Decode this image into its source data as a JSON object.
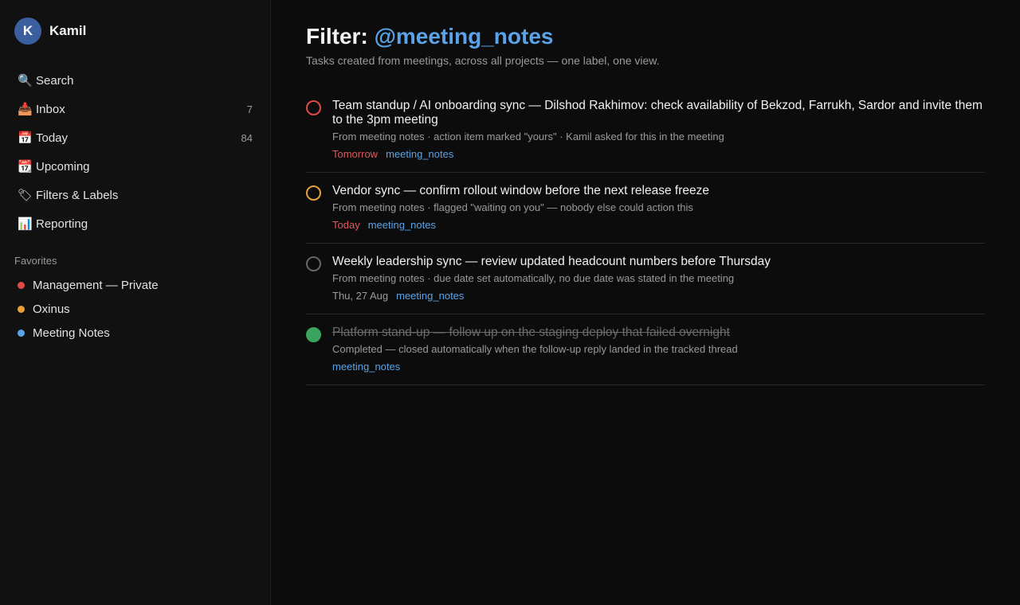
{
  "user": {
    "initial": "K",
    "name": "Kamil"
  },
  "nav": [
    {
      "icon": "🔍",
      "icon_name": "search-icon",
      "label": "Search",
      "count": ""
    },
    {
      "icon": "📥",
      "icon_name": "inbox-icon",
      "label": "Inbox",
      "count": "7"
    },
    {
      "icon": "📅",
      "icon_name": "calendar-icon",
      "label": "Today",
      "count": "84"
    },
    {
      "icon": "📆",
      "icon_name": "upcoming-calendar-icon",
      "label": "Upcoming",
      "count": ""
    },
    {
      "icon": "🏷",
      "icon_name": "label-tag-icon",
      "label": "Filters & Labels",
      "count": ""
    },
    {
      "icon": "📊",
      "icon_name": "bar-chart-icon",
      "label": "Reporting",
      "count": ""
    }
  ],
  "favorites": {
    "title": "Favorites",
    "items": [
      {
        "label": "Management — Private",
        "color": "#e04a4a"
      },
      {
        "label": "Oxinus",
        "color": "#e8a13a"
      },
      {
        "label": "Meeting Notes",
        "color": "#5ba3e8"
      }
    ]
  },
  "header": {
    "prefix": "Filter: ",
    "filter": "@meeting_notes",
    "subtitle": "Tasks created from meetings, across all projects — one label, one view."
  },
  "tasks": [
    {
      "title": "Team standup / AI onboarding sync — Dilshod Rakhimov: check availability of Bekzod, Farrukh, Sardor and invite them to the 3pm meeting",
      "meta": "From meeting notes · action item marked \"yours\" · Kamil asked for this in the meeting",
      "due": "Tomorrow",
      "label": "meeting_notes",
      "priority_color": "#e04a4a",
      "completed": false
    },
    {
      "title": "Vendor sync — confirm rollout window before the next release freeze",
      "meta": "From meeting notes · flagged \"waiting on you\" — nobody else could action this",
      "due": "Today",
      "label": "meeting_notes",
      "priority_color": "#e8a13a",
      "completed": false
    },
    {
      "title": "Weekly leadership sync — review updated headcount numbers before Thursday",
      "meta": "From meeting notes · due date set automatically, no due date was stated in the meeting",
      "due": "Thu, 27 Aug",
      "label": "meeting_notes",
      "priority_color": "#666666",
      "completed": false
    },
    {
      "title": "Platform stand-up — follow up on the staging deploy that failed overnight",
      "meta": "Completed — closed automatically when the follow-up reply landed in the tracked thread",
      "due": "",
      "label": "meeting_notes",
      "priority_color": "#3aa45f",
      "completed": true
    }
  ]
}
